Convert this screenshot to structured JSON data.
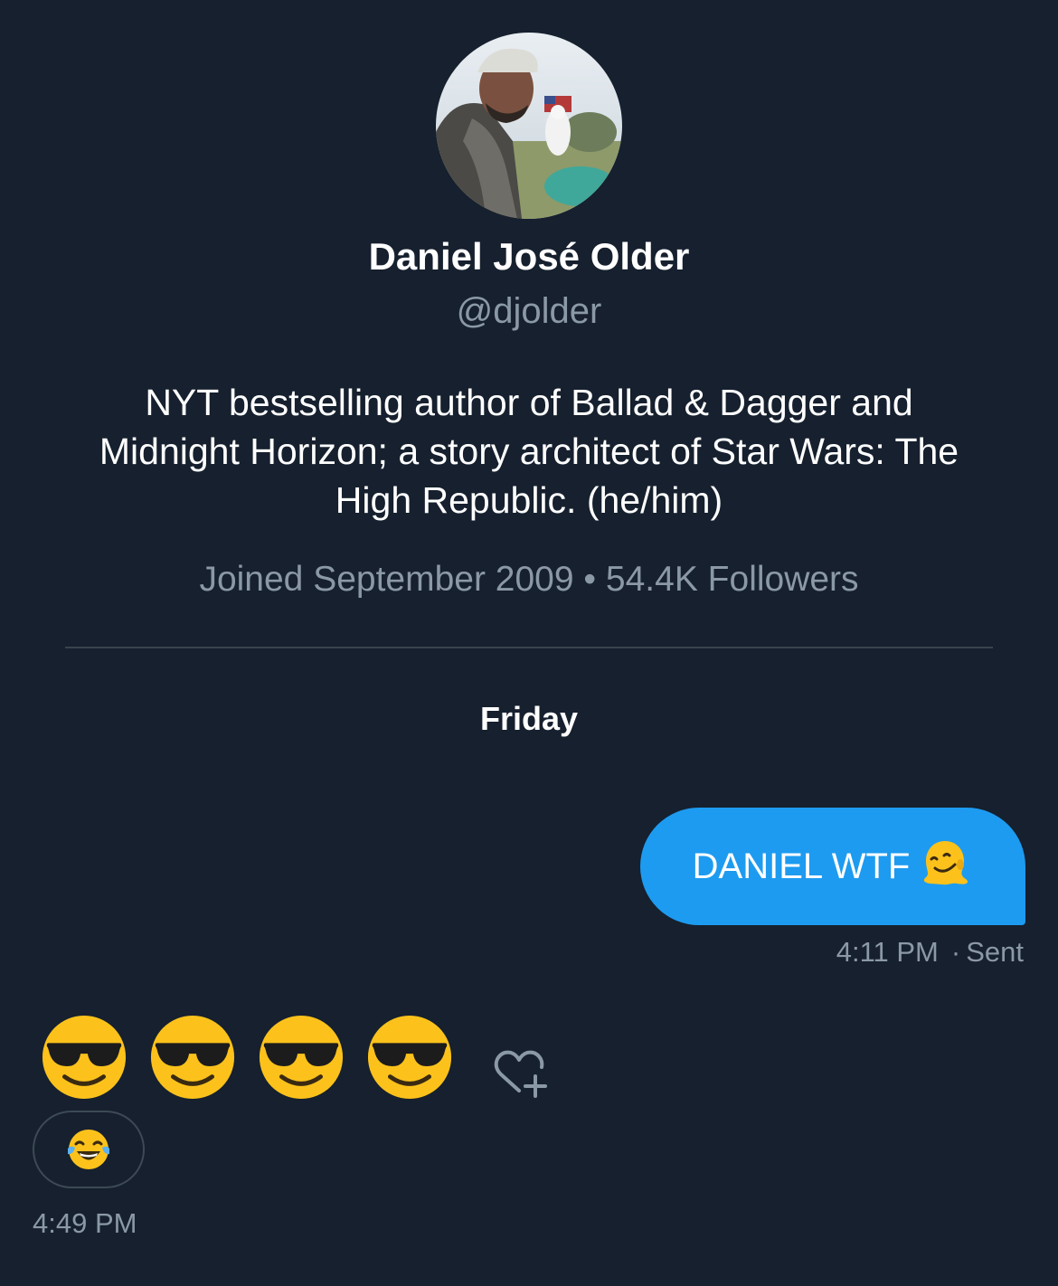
{
  "profile": {
    "display_name": "Daniel José Older",
    "handle": "@djolder",
    "bio": "NYT bestselling author of Ballad & Dagger and Midnight Horizon; a story architect of Star Wars: The High Republic. (he/him)",
    "joined": "Joined September 2009",
    "separator": "•",
    "followers": "54.4K Followers"
  },
  "conversation": {
    "day_label": "Friday",
    "sent_message": {
      "text": "DANIEL WTF",
      "emoji": "melting-face",
      "time": "4:11 PM",
      "separator": "·",
      "status": "Sent"
    },
    "received_message": {
      "emojis": [
        "smiling-face-with-sunglasses",
        "smiling-face-with-sunglasses",
        "smiling-face-with-sunglasses",
        "smiling-face-with-sunglasses"
      ],
      "reaction": "face-with-tears-of-joy",
      "time": "4:49 PM"
    }
  },
  "colors": {
    "background": "#16202e",
    "bubble": "#1d9bf0",
    "muted_text": "#8b98a5",
    "divider": "#38444d"
  }
}
